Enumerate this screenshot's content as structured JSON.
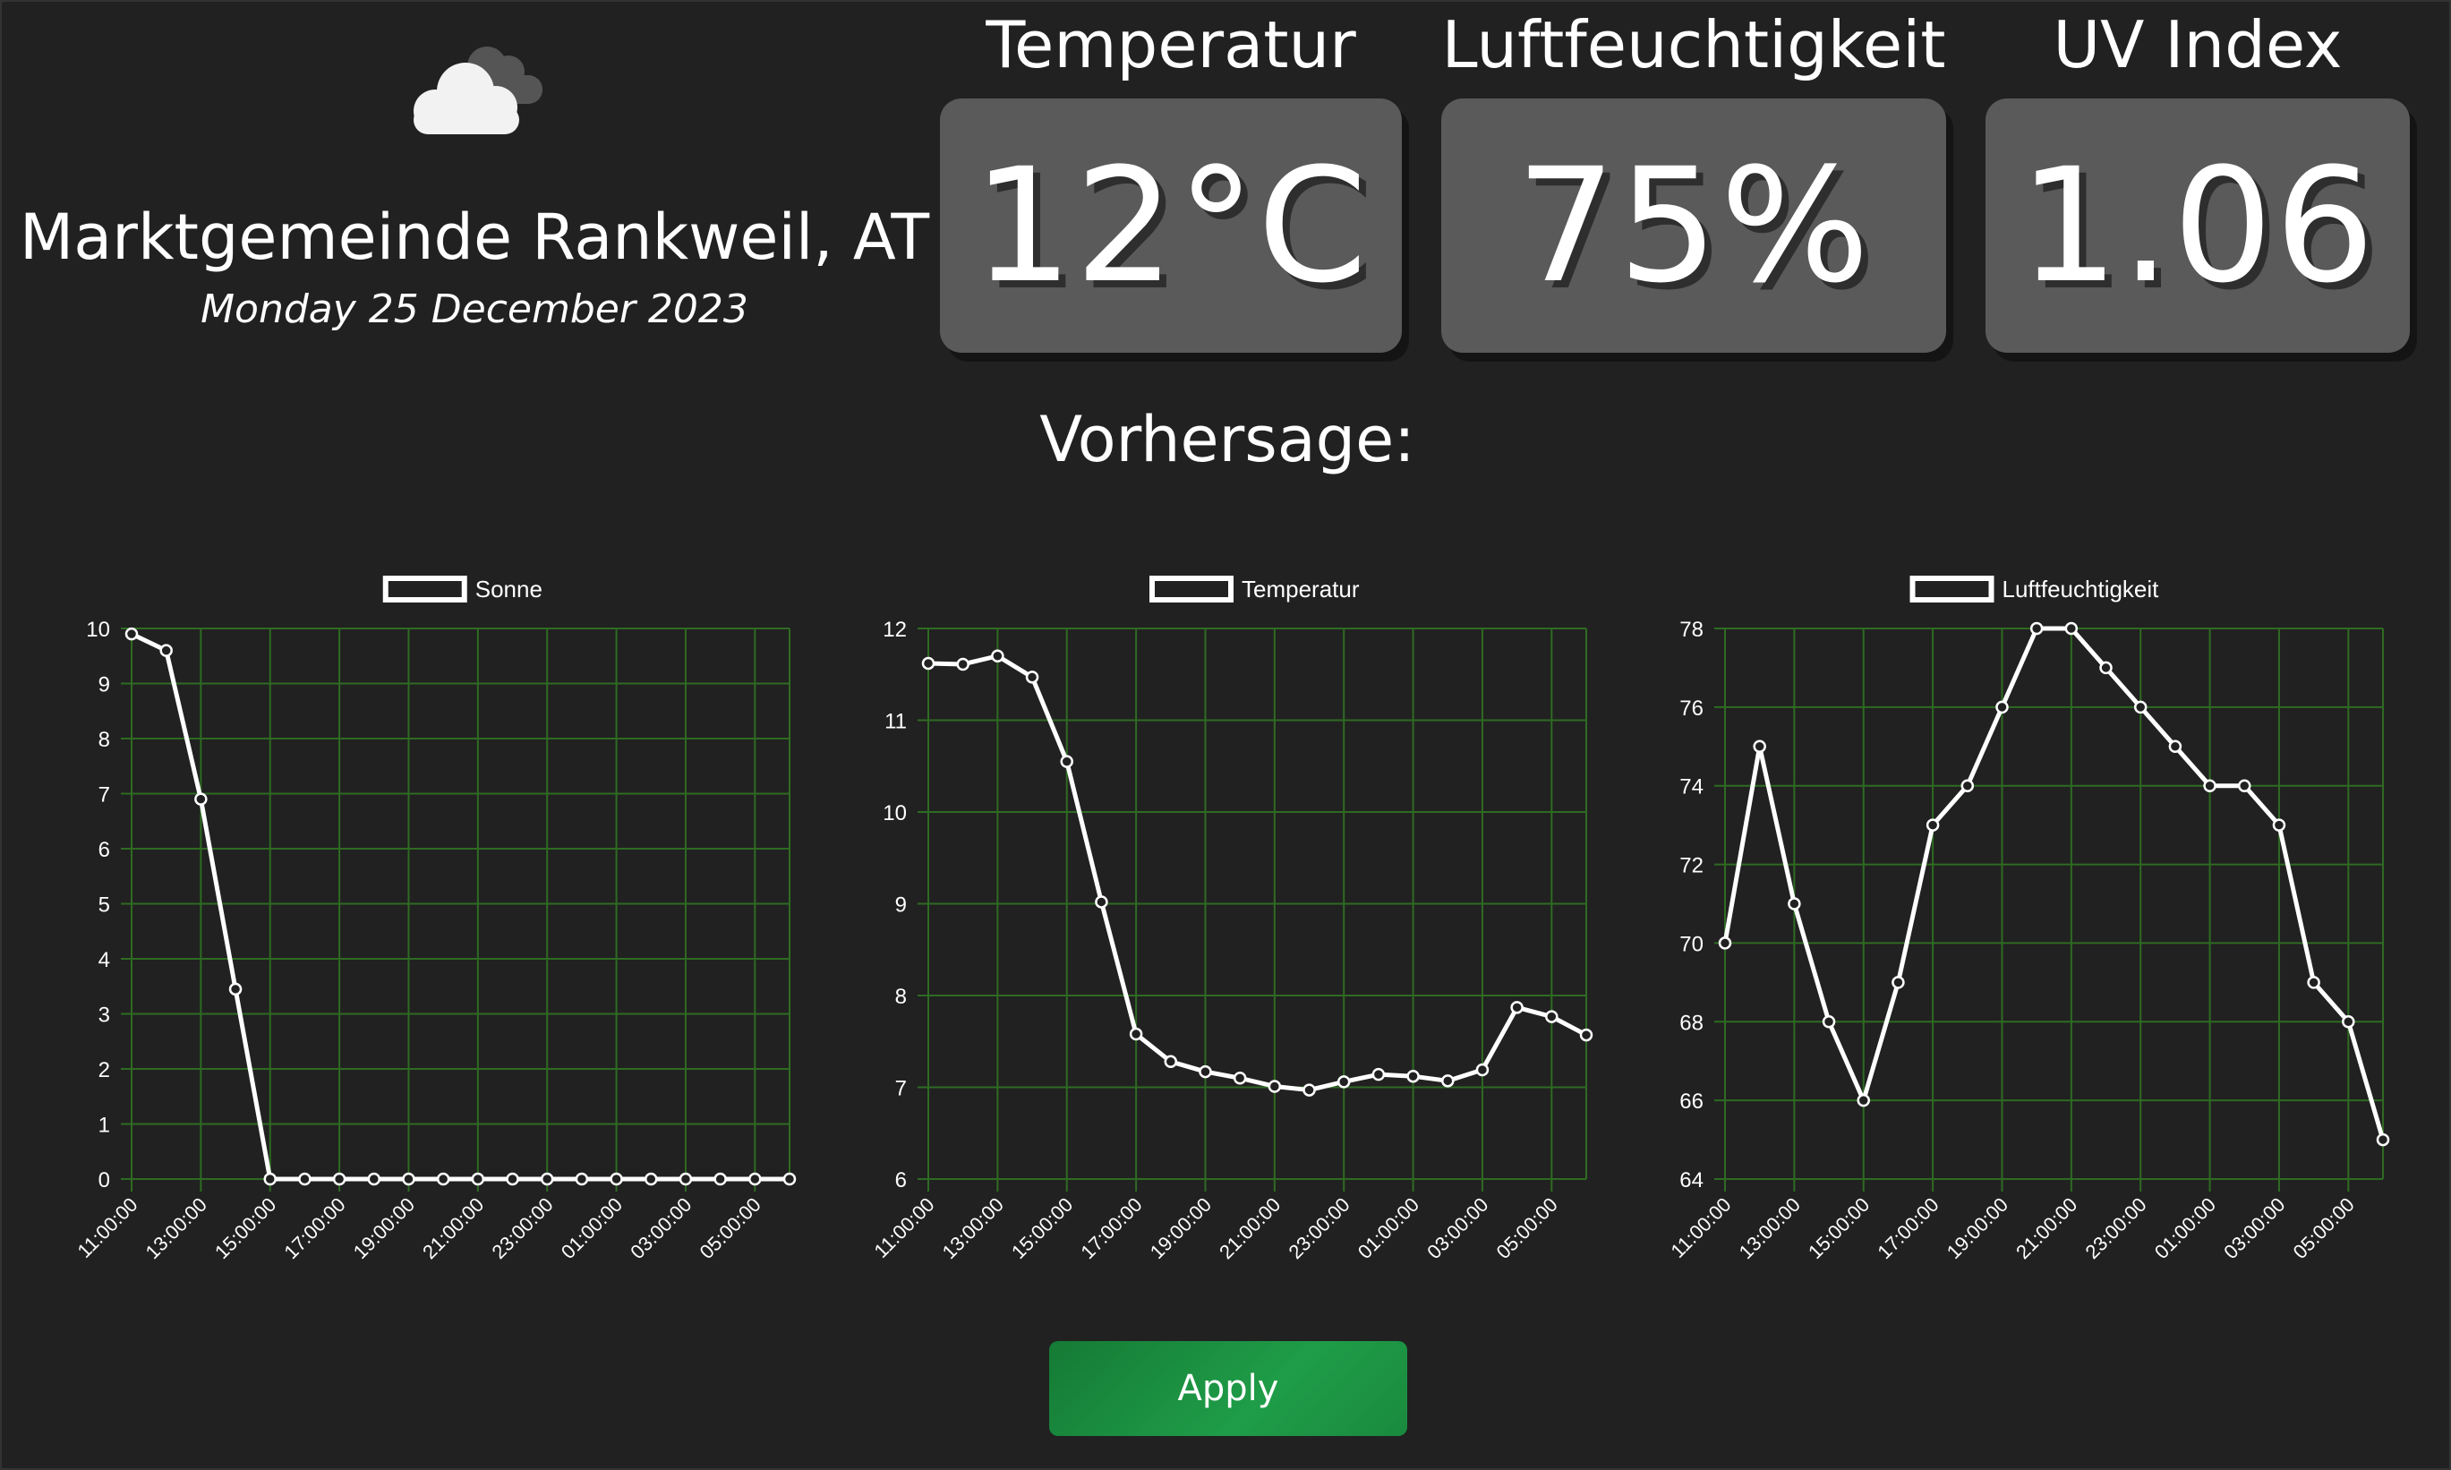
{
  "header": {
    "location": "Marktgemeinde Rankweil, AT",
    "date": "Monday 25 December 2023",
    "weather_icon": "cloud-icon"
  },
  "stats": [
    {
      "title": "Temperatur",
      "value": "12°C"
    },
    {
      "title": "Luftfeuchtigkeit",
      "value": "75%"
    },
    {
      "title": "UV Index",
      "value": "1.06"
    }
  ],
  "forecast": {
    "title": "Vorhersage:"
  },
  "apply_button": {
    "label": "Apply"
  },
  "colors": {
    "background": "#212121",
    "grid": "#2e6b22",
    "line": "#ffffff",
    "stat_box": "#5a5a5a",
    "button": "#1a8a3e"
  },
  "chart_data": [
    {
      "type": "line",
      "legend": "Sonne",
      "x": [
        "11:00:00",
        "12:00:00",
        "13:00:00",
        "14:00:00",
        "15:00:00",
        "16:00:00",
        "17:00:00",
        "18:00:00",
        "19:00:00",
        "20:00:00",
        "21:00:00",
        "22:00:00",
        "23:00:00",
        "00:00:00",
        "01:00:00",
        "02:00:00",
        "03:00:00",
        "04:00:00",
        "05:00:00",
        "06:00:00"
      ],
      "tick_labels": [
        "11:00:00",
        "13:00:00",
        "15:00:00",
        "17:00:00",
        "19:00:00",
        "21:00:00",
        "23:00:00",
        "01:00:00",
        "03:00:00",
        "05:00:00"
      ],
      "values": [
        9.9,
        9.6,
        6.9,
        3.45,
        0,
        0,
        0,
        0,
        0,
        0,
        0,
        0,
        0,
        0,
        0,
        0,
        0,
        0,
        0,
        0
      ],
      "ylim": [
        0,
        10
      ],
      "yticks": [
        0,
        1,
        2,
        3,
        4,
        5,
        6,
        7,
        8,
        9,
        10
      ],
      "grid": true,
      "legend_position": "top"
    },
    {
      "type": "line",
      "legend": "Temperatur",
      "x": [
        "11:00:00",
        "12:00:00",
        "13:00:00",
        "14:00:00",
        "15:00:00",
        "16:00:00",
        "17:00:00",
        "18:00:00",
        "19:00:00",
        "20:00:00",
        "21:00:00",
        "22:00:00",
        "23:00:00",
        "00:00:00",
        "01:00:00",
        "02:00:00",
        "03:00:00",
        "04:00:00",
        "05:00:00",
        "06:00:00"
      ],
      "tick_labels": [
        "11:00:00",
        "13:00:00",
        "15:00:00",
        "17:00:00",
        "19:00:00",
        "21:00:00",
        "23:00:00",
        "01:00:00",
        "03:00:00",
        "05:00:00"
      ],
      "values": [
        11.62,
        11.61,
        11.7,
        11.47,
        10.55,
        9.02,
        7.58,
        7.28,
        7.17,
        7.1,
        7.01,
        6.97,
        7.06,
        7.14,
        7.12,
        7.07,
        7.19,
        7.87,
        7.77,
        7.57
      ],
      "ylim": [
        6,
        12
      ],
      "yticks": [
        6,
        7,
        8,
        9,
        10,
        11,
        12
      ],
      "grid": true,
      "legend_position": "top"
    },
    {
      "type": "line",
      "legend": "Luftfeuchtigkeit",
      "x": [
        "11:00:00",
        "12:00:00",
        "13:00:00",
        "14:00:00",
        "15:00:00",
        "16:00:00",
        "17:00:00",
        "18:00:00",
        "19:00:00",
        "20:00:00",
        "21:00:00",
        "22:00:00",
        "23:00:00",
        "00:00:00",
        "01:00:00",
        "02:00:00",
        "03:00:00",
        "04:00:00",
        "05:00:00",
        "06:00:00"
      ],
      "tick_labels": [
        "11:00:00",
        "13:00:00",
        "15:00:00",
        "17:00:00",
        "19:00:00",
        "21:00:00",
        "23:00:00",
        "01:00:00",
        "03:00:00",
        "05:00:00"
      ],
      "values": [
        70,
        75,
        71,
        68,
        66,
        69,
        73,
        74,
        76,
        78,
        78,
        77,
        76,
        75,
        74,
        74,
        73,
        69,
        68,
        65
      ],
      "ylim": [
        64,
        78
      ],
      "yticks": [
        64,
        66,
        68,
        70,
        72,
        74,
        76,
        78
      ],
      "grid": true,
      "legend_position": "top"
    }
  ]
}
